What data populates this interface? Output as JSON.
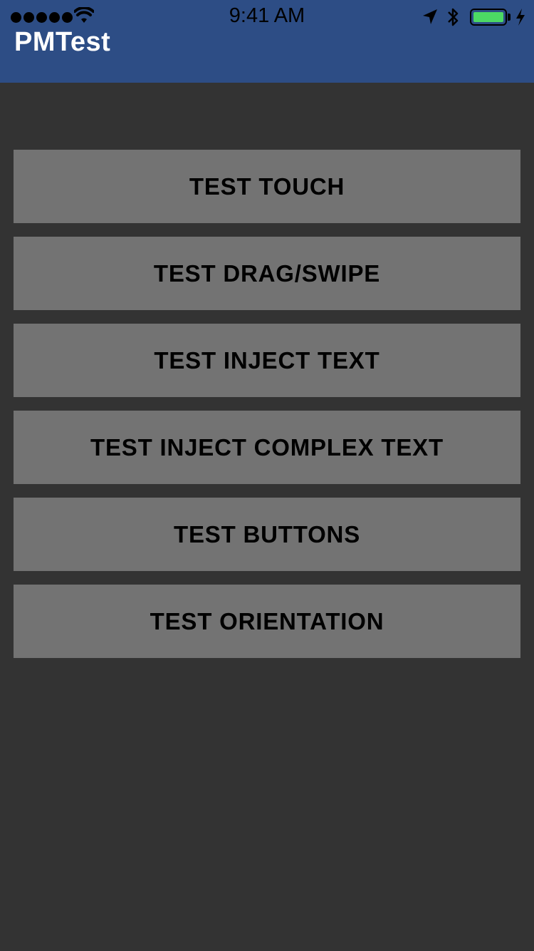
{
  "status_bar": {
    "time": "9:41 AM",
    "signal_icon": "signal-dots-icon",
    "wifi_icon": "wifi-icon",
    "location_icon": "location-arrow-icon",
    "bluetooth_icon": "bluetooth-icon",
    "battery_level": 1.0,
    "charging_icon": "charging-bolt-icon"
  },
  "header": {
    "title": "PMTest",
    "background_color": "#2d4d85"
  },
  "colors": {
    "background": "#333333",
    "button_background": "#737373",
    "button_text": "#000000",
    "battery_fill": "#4cd964"
  },
  "menu": {
    "buttons": [
      {
        "label": "TEST TOUCH"
      },
      {
        "label": "TEST DRAG/SWIPE"
      },
      {
        "label": "TEST INJECT TEXT"
      },
      {
        "label": "TEST INJECT COMPLEX TEXT"
      },
      {
        "label": "TEST BUTTONS"
      },
      {
        "label": "TEST ORIENTATION"
      }
    ]
  }
}
